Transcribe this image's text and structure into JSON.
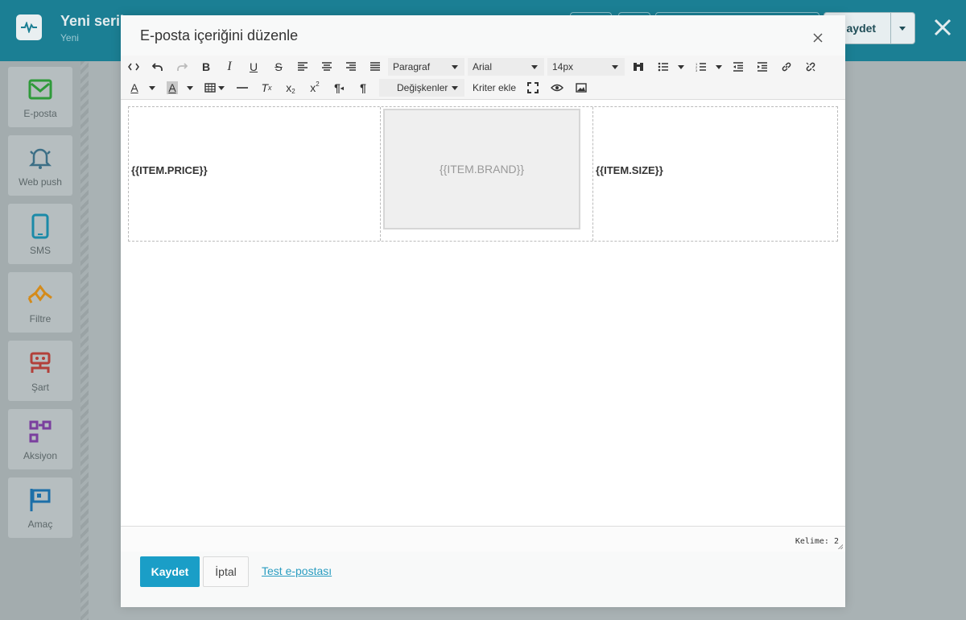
{
  "app": {
    "title": "Yeni seril",
    "subtitle": "Yeni",
    "save_label": "aydet",
    "icons": {
      "logo": "activity-pulse-icon",
      "close": "close-icon",
      "caret": "chevron-down-icon"
    }
  },
  "sidebar": {
    "items": [
      {
        "label": "E-posta",
        "icon": "envelope-icon",
        "color": "#2f9a3a"
      },
      {
        "label": "Web push",
        "icon": "bell-icon",
        "color": "#3c6f86"
      },
      {
        "label": "SMS",
        "icon": "mobile-phone-icon",
        "color": "#1b8aa8"
      },
      {
        "label": "Filtre",
        "icon": "filter-branch-icon",
        "color": "#d48b1b"
      },
      {
        "label": "Şart",
        "icon": "condition-robot-icon",
        "color": "#b2403a"
      },
      {
        "label": "Aksiyon",
        "icon": "action-arrows-icon",
        "color": "#7a3f9e"
      },
      {
        "label": "Amaç",
        "icon": "goal-flag-icon",
        "color": "#1c6fa8"
      }
    ]
  },
  "modal": {
    "title": "E-posta içeriğini düzenle",
    "toolbar": {
      "format_select": "Paragraf",
      "font_select": "Arial",
      "size_select": "14px",
      "variables_label": "Değişkenler",
      "criteria_label": "Kriter ekle"
    },
    "content": {
      "cell1": "{{ITEM.PRICE}}",
      "cell2_placeholder": "{{ITEM.BRAND}}",
      "cell3": "{{ITEM.SIZE}}"
    },
    "status": {
      "word_count": "Kelime: 2"
    },
    "footer": {
      "save": "Kaydet",
      "cancel": "İptal",
      "test_email": "Test e-postası"
    }
  },
  "colors": {
    "topbar": "#1b7f94",
    "primary_button": "#1a9ec7",
    "link": "#2a9dc1"
  }
}
